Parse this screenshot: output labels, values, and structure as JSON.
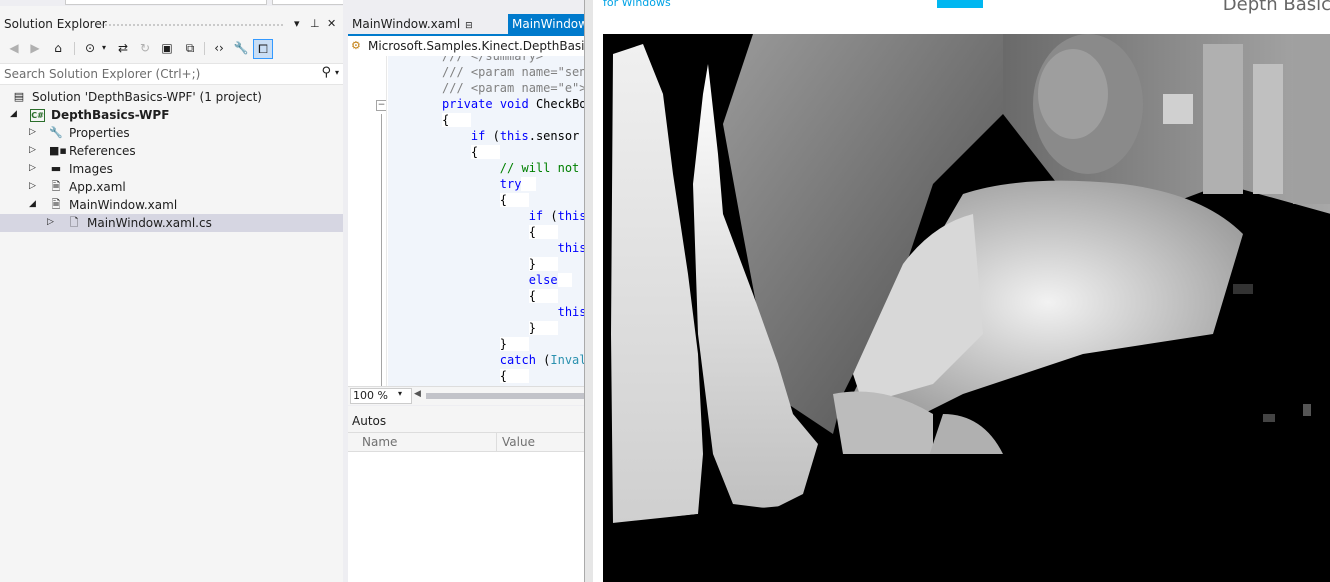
{
  "solution_explorer": {
    "title": "Solution Explorer",
    "pin_icon": "pin-icon",
    "close_icon": "close-icon",
    "search_placeholder": "Search Solution Explorer (Ctrl+;)",
    "tree": [
      {
        "label": "Solution 'DepthBasics-WPF' (1 project)",
        "icon": "solution-icon",
        "expanded": false
      },
      {
        "label": "DepthBasics-WPF",
        "icon": "csharp-project-icon",
        "badge": "C#",
        "expanded": true
      },
      {
        "label": "Properties",
        "icon": "wrench-icon"
      },
      {
        "label": "References",
        "icon": "references-icon"
      },
      {
        "label": "Images",
        "icon": "folder-icon"
      },
      {
        "label": "App.xaml",
        "icon": "xaml-file-icon"
      },
      {
        "label": "MainWindow.xaml",
        "icon": "xaml-file-icon",
        "expanded": true
      },
      {
        "label": "MainWindow.xaml.cs",
        "icon": "cs-file-icon",
        "selected": true
      }
    ]
  },
  "editor": {
    "tabs": [
      {
        "label": "MainWindow.xaml",
        "active": false
      },
      {
        "label": "MainWindow",
        "active": true
      }
    ],
    "navbar": "Microsoft.Samples.Kinect.DepthBasics.M",
    "zoom": "100 %",
    "code_lines": [
      "/// </summary>",
      "/// <param name=\"send",
      "/// <param name=\"e\">",
      "private void CheckBox",
      "{",
      "    if (this.sensor",
      "    {",
      "        // will not",
      "        try",
      "        {",
      "            if (this",
      "            {",
      "                this",
      "            }",
      "            else",
      "            {",
      "                this",
      "            }",
      "        }",
      "        catch (Inval",
      "        {"
    ]
  },
  "autos": {
    "title": "Autos",
    "col_name": "Name",
    "col_value": "Value"
  },
  "depth_window": {
    "brand": "for Windows",
    "title": "Depth Basic"
  }
}
